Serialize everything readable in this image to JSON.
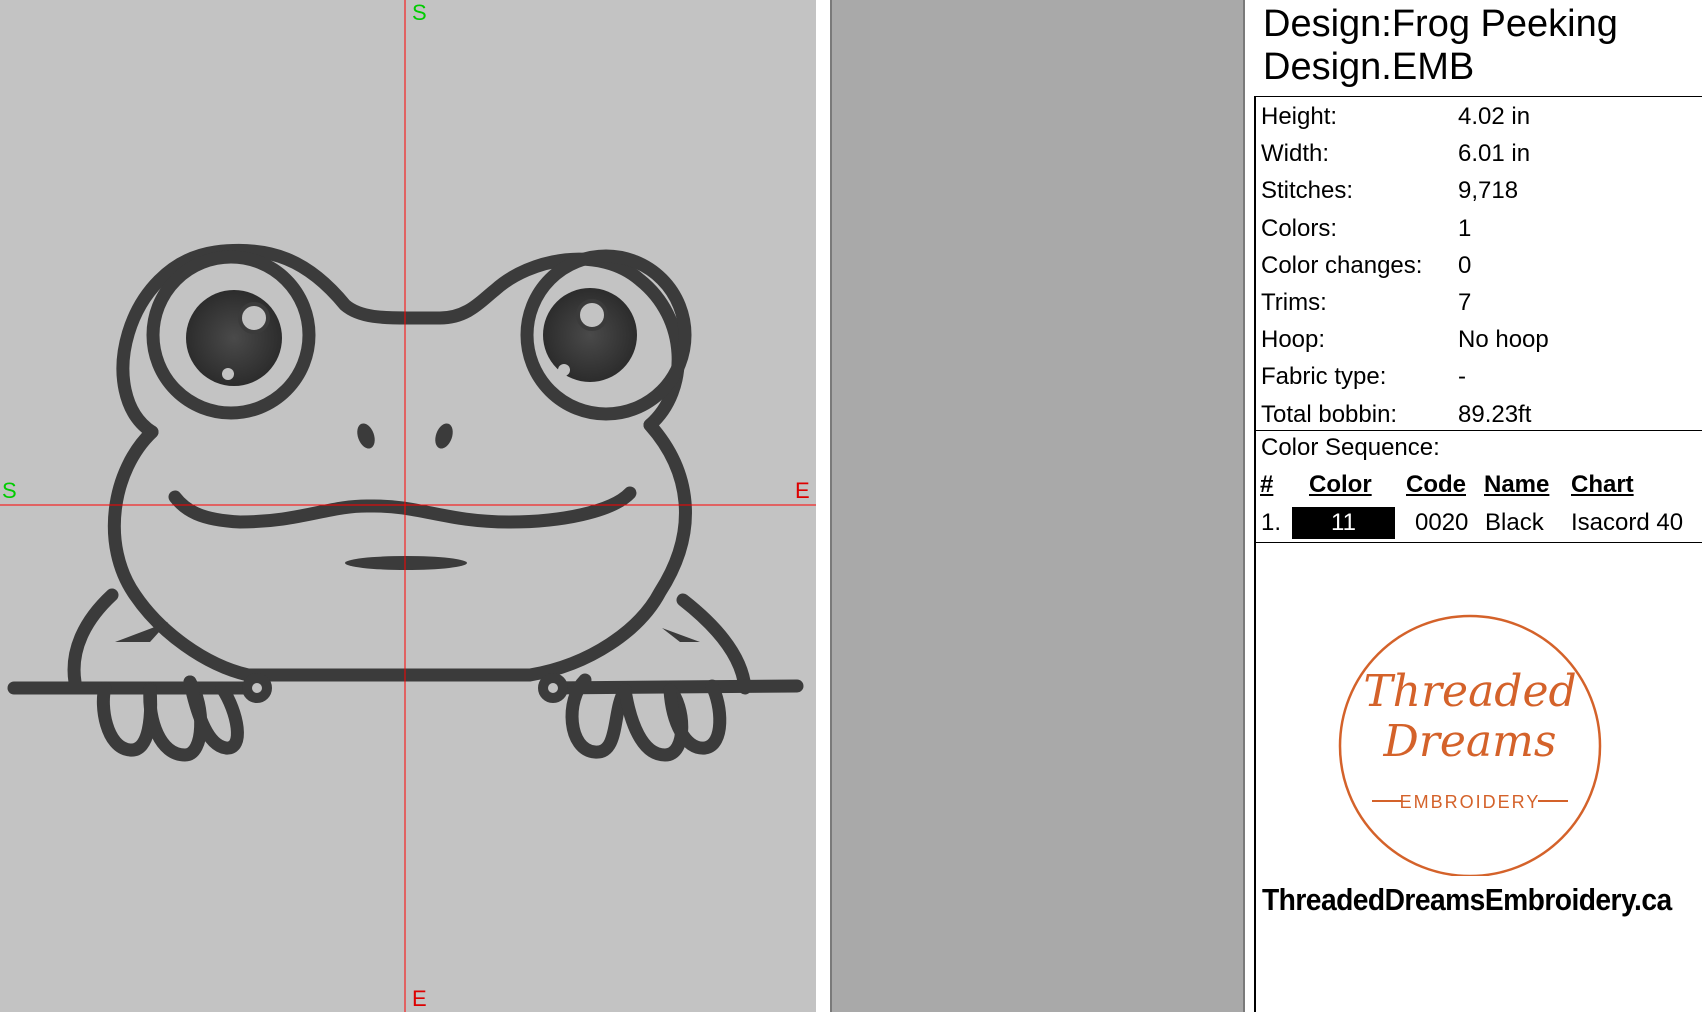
{
  "canvas": {
    "axis_labels": {
      "top": "S",
      "left": "S",
      "right": "E",
      "bottom": "E"
    },
    "colors": {
      "background": "#c3c3c3",
      "axis": "#ff0000",
      "label_start": "#00cc00",
      "label_end": "#dd0000",
      "stitch": "#3b3b3b"
    },
    "design_icon": "frog-embroidery"
  },
  "design": {
    "title_line1": "Design:Frog Peeking",
    "title_line2": "Design.EMB"
  },
  "properties": [
    {
      "label": "Height:",
      "value": "4.02 in"
    },
    {
      "label": "Width:",
      "value": "6.01 in"
    },
    {
      "label": "Stitches:",
      "value": "9,718"
    },
    {
      "label": "Colors:",
      "value": "1"
    },
    {
      "label": "Color changes:",
      "value": "0"
    },
    {
      "label": "Trims:",
      "value": "7"
    },
    {
      "label": "Hoop:",
      "value": "No hoop"
    },
    {
      "label": "Fabric type:",
      "value": "-"
    },
    {
      "label": "Total bobbin:",
      "value": "89.23ft"
    }
  ],
  "color_sequence": {
    "title": "Color Sequence:",
    "headers": {
      "num": "#",
      "color": "Color",
      "code": "Code",
      "name": "Name",
      "chart": "Chart"
    },
    "rows": [
      {
        "num": "1.",
        "color": "11",
        "swatch": "#000000",
        "code": "0020",
        "name": "Black",
        "chart": "Isacord 40"
      }
    ]
  },
  "logo": {
    "line1": "Threaded",
    "line2": "Dreams",
    "line3": "EMBROIDERY",
    "url": "ThreadedDreamsEmbroidery.ca",
    "accent": "#d4622a"
  }
}
